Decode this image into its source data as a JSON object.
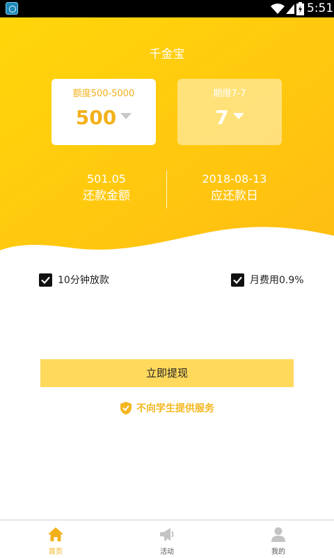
{
  "status_bar": {
    "time": "5:51",
    "app_icon": "app-launcher-icon",
    "icons": [
      "wifi-icon",
      "signal-icon",
      "battery-charging-icon"
    ]
  },
  "header": {
    "title": "千金宝"
  },
  "cards": {
    "amount": {
      "label": "额度500-5000",
      "value": "500"
    },
    "term": {
      "label": "期限7-7",
      "value": "7"
    }
  },
  "stats": {
    "repay_amount": {
      "value": "501.05",
      "label": "还款金额"
    },
    "due_date": {
      "value": "2018-08-13",
      "label": "应还款日"
    }
  },
  "options": {
    "fast_loan": {
      "label": "10分钟放款",
      "checked": true
    },
    "monthly_fee": {
      "label": "月费用0.9%",
      "checked": true
    }
  },
  "actions": {
    "withdraw_label": "立即提现"
  },
  "notice": {
    "label": "不向学生提供服务",
    "icon": "shield-check-icon"
  },
  "tab_bar": {
    "tabs": [
      {
        "label": "首页",
        "icon": "home-icon",
        "active": true
      },
      {
        "label": "活动",
        "icon": "megaphone-icon",
        "active": false
      },
      {
        "label": "我的",
        "icon": "user-icon",
        "active": false
      }
    ]
  },
  "colors": {
    "accent": "#f2b11a",
    "hero_gradient_start": "#ffd60a",
    "hero_gradient_end": "#ffbd12",
    "button_bg": "#ffd95c"
  }
}
